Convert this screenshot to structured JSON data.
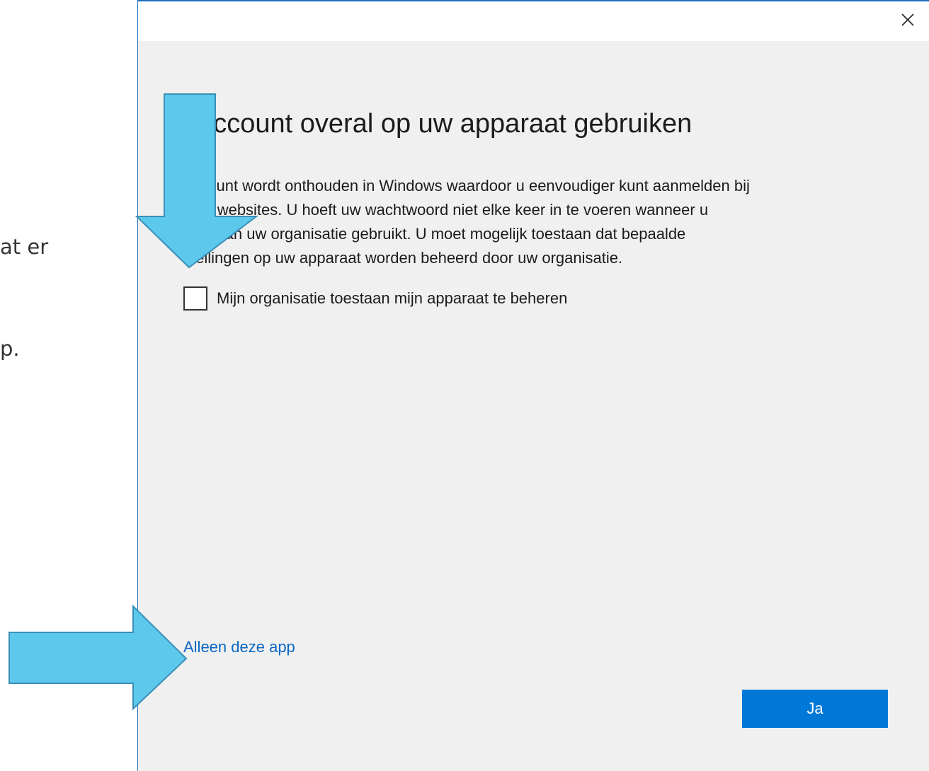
{
  "background": {
    "line_1": "at er",
    "line_2": "p."
  },
  "dialog": {
    "title": "t account overal op uw apparaat gebruiken",
    "body_lines": [
      "account wordt onthouden in Windows waardoor u eenvoudiger kunt aanmelden bij",
      "s en websites. U hoeft uw wachtwoord niet elke keer in te voeren wanneer u",
      "rces van uw organisatie gebruikt. U moet mogelijk toestaan dat bepaalde",
      "stellingen op uw apparaat worden beheerd door uw organisatie."
    ],
    "checkbox": {
      "label": "Mijn organisatie toestaan mijn apparaat te beheren",
      "checked": false
    },
    "link_label": "Alleen deze app",
    "primary_button_label": "Ja",
    "close_icon": "close-icon"
  },
  "annotations": {
    "arrow_color": "#5bc8ec",
    "arrow_outline": "#3a8fb7",
    "arrows": [
      "down-arrow-icon",
      "right-arrow-icon"
    ]
  },
  "colors": {
    "dialog_background": "#f0f0f0",
    "accent": "#0078d7",
    "link": "#0a67c5",
    "window_border": "#1e6fbf"
  }
}
